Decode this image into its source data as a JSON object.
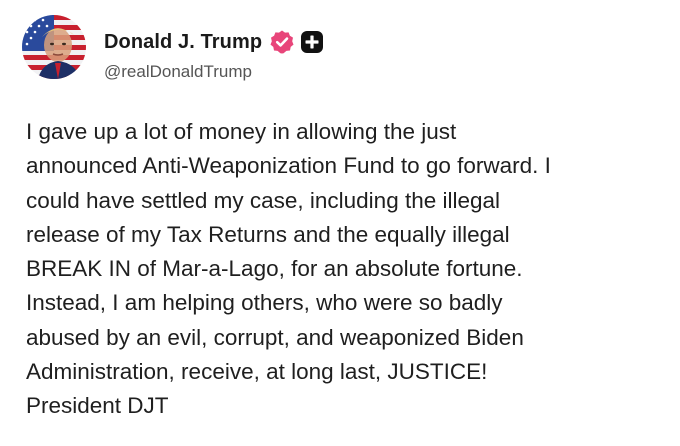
{
  "author": {
    "display_name": "Donald J. Trump",
    "handle": "@realDonaldTrump",
    "avatar_icon": "flag-portrait-avatar",
    "verified_icon": "verified-badge-icon",
    "verified_color": "#e8457a",
    "plus_icon": "plus-box-icon"
  },
  "post": {
    "lines": [
      "I gave up a lot of money in allowing the just",
      "announced Anti-Weaponization Fund to go forward. I",
      "could have settled my case, including the illegal",
      "release of my Tax Returns and the equally illegal",
      "BREAK IN of Mar-a-Lago, for an absolute fortune.",
      "Instead, I am helping others, who were so badly",
      "abused by an evil, corrupt, and weaponized Biden",
      "Administration, receive, at long last, JUSTICE!",
      "President DJT"
    ]
  }
}
